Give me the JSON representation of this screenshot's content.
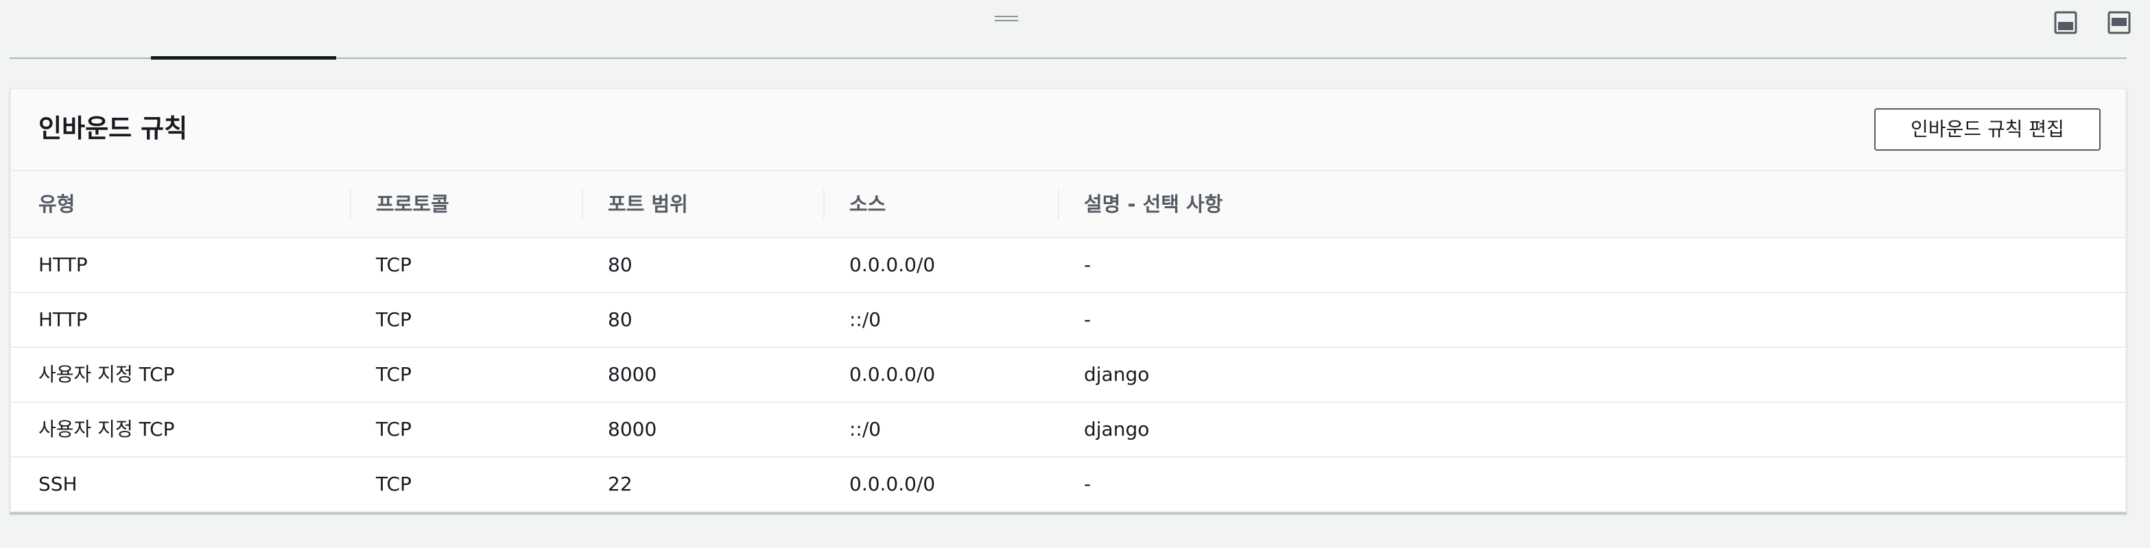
{
  "drawer": {
    "drag_handle_icon": "drag-handle-icon",
    "panel_button_1_icon": "panel-bottom-icon",
    "panel_button_2_icon": "panel-bottom-icon"
  },
  "inbound_rules": {
    "title": "인바운드 규칙",
    "edit_button_label": "인바운드 규칙 편집",
    "columns": [
      "유형",
      "프로토콜",
      "포트 범위",
      "소스",
      "설명 - 선택 사항"
    ],
    "rows": [
      [
        "HTTP",
        "TCP",
        "80",
        "0.0.0.0/0",
        "-"
      ],
      [
        "HTTP",
        "TCP",
        "80",
        "::/0",
        "-"
      ],
      [
        "사용자 지정 TCP",
        "TCP",
        "8000",
        "0.0.0.0/0",
        "django"
      ],
      [
        "사용자 지정 TCP",
        "TCP",
        "8000",
        "::/0",
        "django"
      ],
      [
        "SSH",
        "TCP",
        "22",
        "0.0.0.0/0",
        "-"
      ]
    ]
  },
  "colors": {
    "background": "#f2f3f3",
    "text": "#16191f",
    "header_text": "#545b64",
    "border": "#eaeded"
  }
}
